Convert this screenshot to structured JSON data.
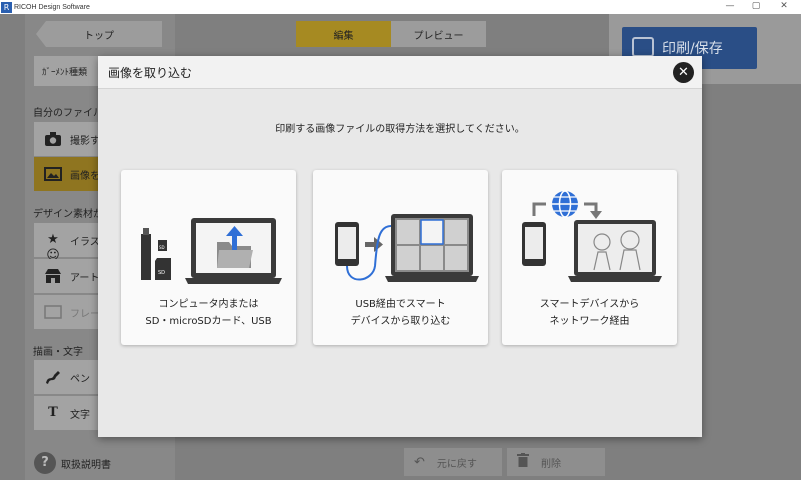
{
  "window": {
    "title": "RICOH Design Software",
    "logo_glyph": "R",
    "minimize_glyph": "—",
    "restore_glyph": "▢",
    "close_glyph": "✕"
  },
  "header": {
    "back_label": "トップ",
    "tabs": [
      {
        "label": "編集",
        "active": true
      },
      {
        "label": "プレビュー",
        "active": false
      }
    ],
    "print_label": "印刷/保存"
  },
  "sidebar": {
    "garment_label": "ｶﾞｰﾒﾝﾄ種類",
    "my_files_heading": "自分のファイル",
    "my_files_items": [
      {
        "label": "撮影す",
        "icon": "camera-icon"
      },
      {
        "label": "画像を",
        "icon": "image-icon",
        "selected": true
      }
    ],
    "design_heading": "デザイン素材から",
    "design_items": [
      {
        "label": "イラス",
        "icon": "stamp-icon"
      },
      {
        "label": "アート",
        "icon": "art-icon"
      },
      {
        "label": "フレー",
        "icon": "frame-icon",
        "disabled": true
      }
    ],
    "draw_heading": "描画・文字",
    "draw_items": [
      {
        "label": "ペン",
        "icon": "pen-icon"
      },
      {
        "label": "文字",
        "icon": "text-icon"
      }
    ]
  },
  "footer": {
    "help_glyph": "?",
    "help_label": "取扱説明書",
    "undo_label": "元に戻す",
    "delete_label": "削除"
  },
  "modal": {
    "title": "画像を取り込む",
    "close_glyph": "✕",
    "instruction": "印刷する画像ファイルの取得方法を選択してください。",
    "options": [
      {
        "line1": "コンピュータ内または",
        "line2": "SD・microSDカード、USB",
        "icon": "computer-folder-icon"
      },
      {
        "line1": "USB経由でスマート",
        "line2": "デバイスから取り込む",
        "icon": "usb-phone-icon"
      },
      {
        "line1": "スマートデバイスから",
        "line2": "ネットワーク経由",
        "icon": "network-phone-icon"
      }
    ]
  },
  "colors": {
    "accent_gold": "#a68a22",
    "print_blue": "#2a4e86",
    "globe_blue": "#2f6fd6"
  }
}
